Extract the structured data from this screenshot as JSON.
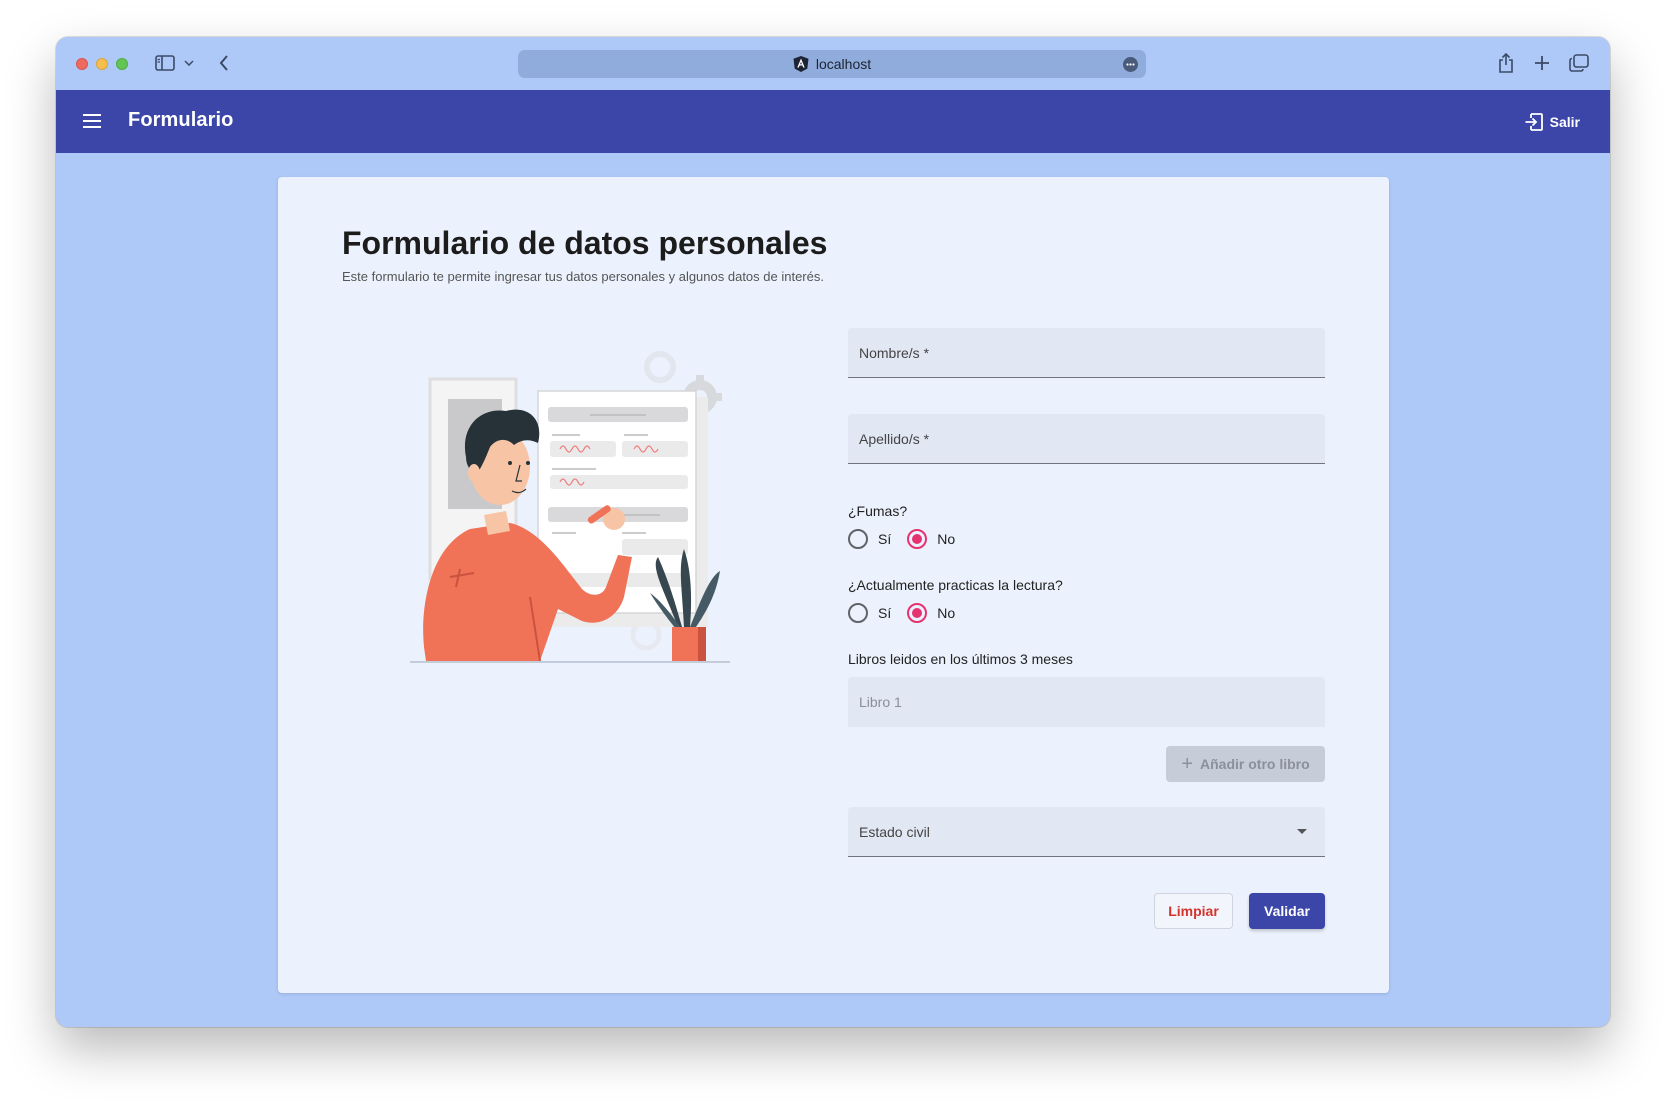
{
  "browser": {
    "url": "localhost"
  },
  "appbar": {
    "title": "Formulario",
    "logout_label": "Salir"
  },
  "form": {
    "title": "Formulario de datos personales",
    "subtitle": "Este formulario te permite ingresar tus datos personales y algunos datos de interés.",
    "nombre_label": "Nombre/s *",
    "apellido_label": "Apellido/s *",
    "fumas": {
      "question": "¿Fumas?",
      "options": [
        "Sí",
        "No"
      ],
      "selected": "No"
    },
    "lectura": {
      "question": "¿Actualmente practicas la lectura?",
      "options": [
        "Sí",
        "No"
      ],
      "selected": "No"
    },
    "libros_label": "Libros leidos en los últimos 3 meses",
    "libro_placeholder": "Libro 1",
    "add_book_label": "Añadir otro libro",
    "estado_civil_label": "Estado civil",
    "clear_label": "Limpiar",
    "validate_label": "Validar"
  },
  "colors": {
    "primary": "#3b46a8",
    "accent": "#e6336f",
    "warn": "#d4342b",
    "background": "#aec8f8",
    "card": "#ecf2fd"
  }
}
